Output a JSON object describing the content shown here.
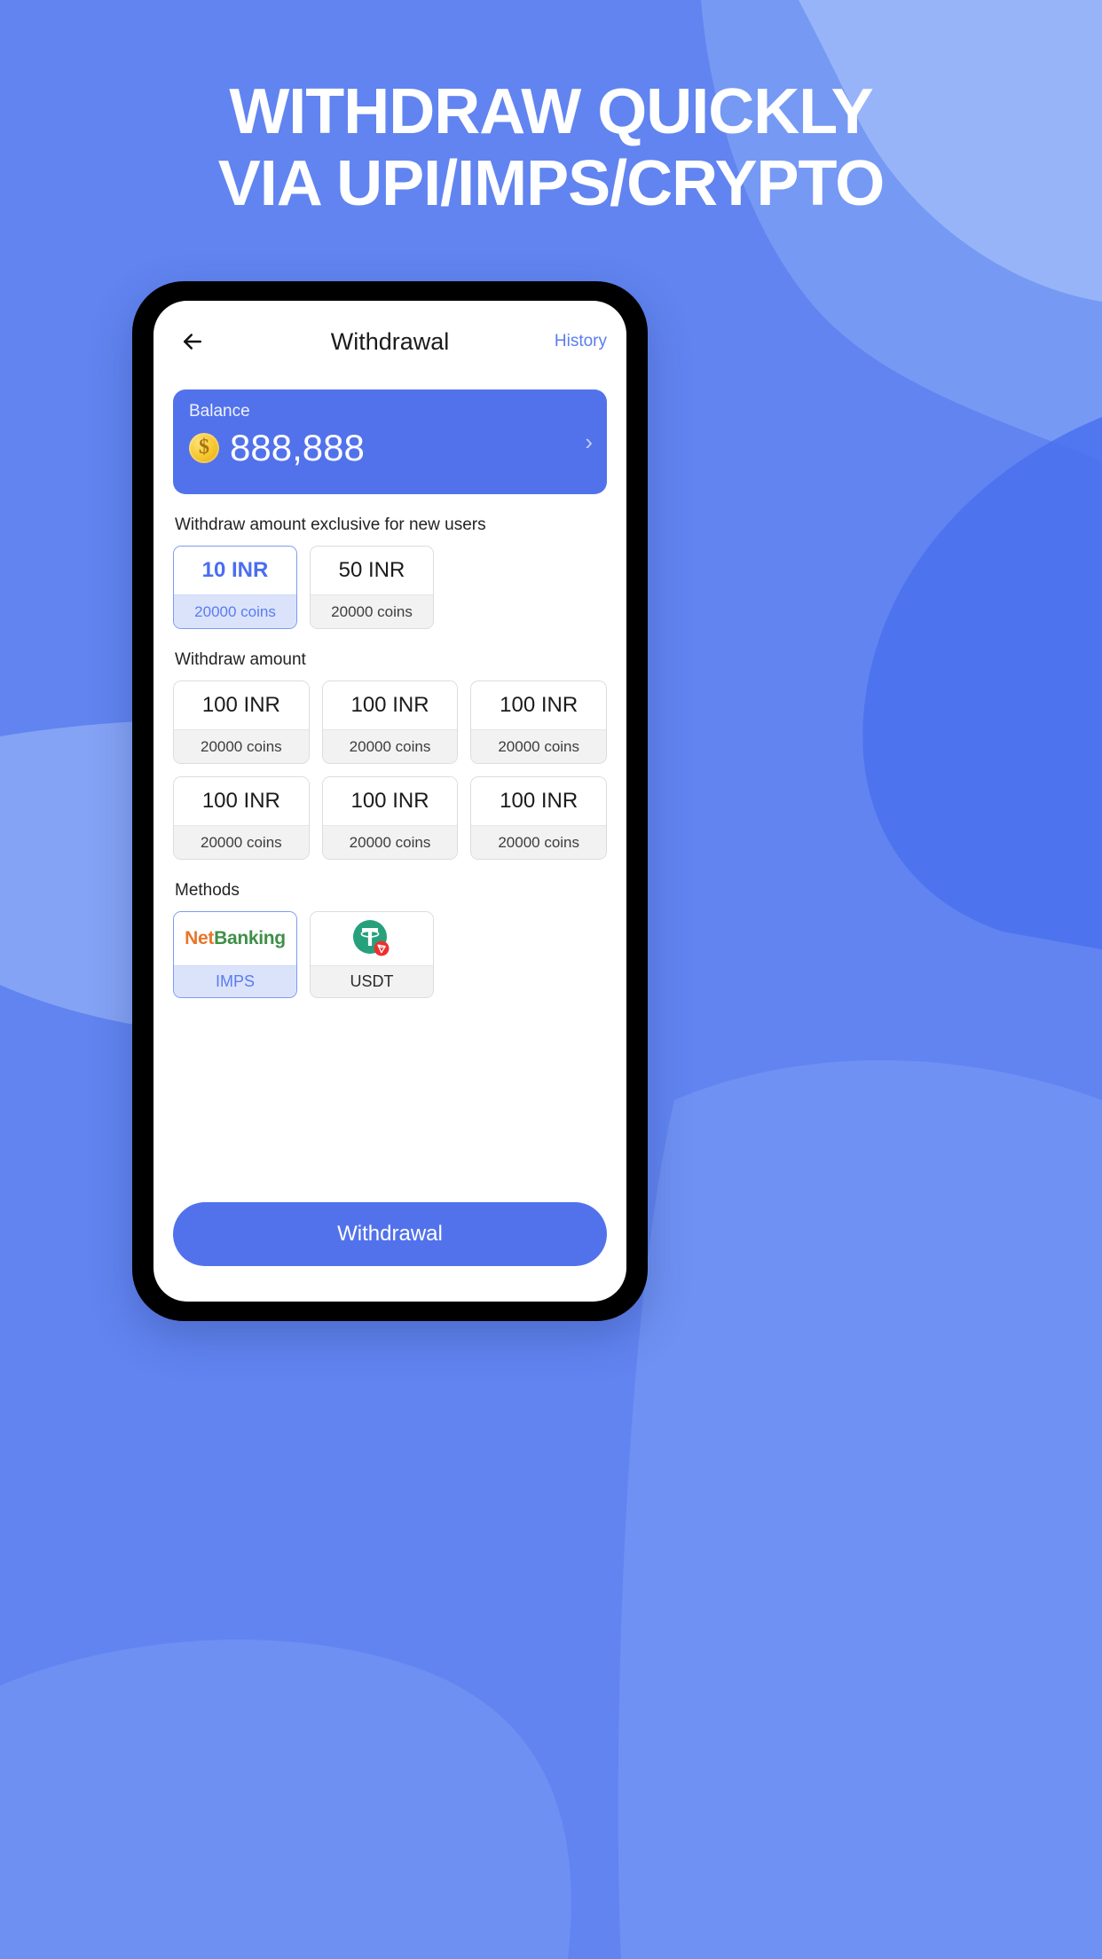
{
  "banner": {
    "headline_line1": "WITHDRAW QUICKLY",
    "headline_line2": "VIA UPI/IMPS/CRYPTO",
    "background_color": "#6184f0",
    "blob_color_light": "#8aa6f5",
    "blob_color_dark": "#4d73ee"
  },
  "app": {
    "header": {
      "back_icon": "arrow-left-icon",
      "title": "Withdrawal",
      "history_label": "History",
      "history_color": "#5a7cf0"
    },
    "balance_card": {
      "label": "Balance",
      "coin_icon": "coin-icon",
      "amount": "888,888",
      "chevron": "›",
      "background_color": "#5272ec"
    },
    "new_user_section": {
      "title": "Withdraw amount exclusive for new users",
      "options": [
        {
          "amount": "10 INR",
          "coins": "20000 coins",
          "selected": true
        },
        {
          "amount": "50 INR",
          "coins": "20000 coins",
          "selected": false
        }
      ]
    },
    "amount_section": {
      "title": "Withdraw amount",
      "rows": [
        [
          {
            "amount": "100 INR",
            "coins": "20000 coins"
          },
          {
            "amount": "100 INR",
            "coins": "20000 coins"
          },
          {
            "amount": "100 INR",
            "coins": "20000 coins"
          }
        ],
        [
          {
            "amount": "100 INR",
            "coins": "20000 coins"
          },
          {
            "amount": "100 INR",
            "coins": "20000 coins"
          },
          {
            "amount": "100 INR",
            "coins": "20000 coins"
          }
        ]
      ]
    },
    "methods_section": {
      "title": "Methods",
      "items": [
        {
          "logo_type": "netbanking-logo",
          "logo_part1": "Net",
          "logo_part2": "Banking",
          "logo_color1": "#e8762a",
          "logo_color2": "#3f8f48",
          "label": "IMPS",
          "selected": true
        },
        {
          "logo_type": "usdt-tron-icon",
          "label": "USDT",
          "selected": false,
          "icon_color": "#26a17b",
          "badge_color": "#ef2f2f"
        }
      ]
    },
    "cta": {
      "label": "Withdrawal",
      "color": "#5272ec"
    }
  }
}
